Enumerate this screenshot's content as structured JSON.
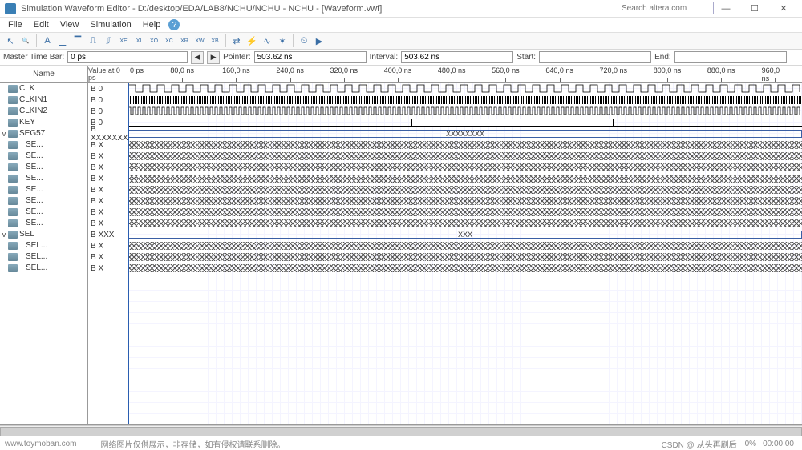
{
  "titlebar": {
    "title": "Simulation Waveform Editor - D:/desktop/EDA/LAB8/NCHU/NCHU - NCHU - [Waveform.vwf]",
    "min": "—",
    "max": "☐",
    "close": "✕"
  },
  "search_placeholder": "Search altera.com",
  "menubar": [
    "File",
    "Edit",
    "View",
    "Simulation",
    "Help"
  ],
  "toolbar_icons": [
    "cursor",
    "zoom",
    "text",
    "wave-a",
    "wave-b",
    "wave-over",
    "wave-under",
    "xe",
    "xi",
    "xo",
    "xc",
    "xr",
    "xw",
    "xb",
    "invert",
    "rand1",
    "rand2",
    "rand3",
    "clock",
    "run"
  ],
  "controlbar": {
    "master_label": "Master Time Bar:",
    "master_value": "0 ps",
    "pointer_label": "Pointer:",
    "pointer_value": "503.62 ns",
    "interval_label": "Interval:",
    "interval_value": "503.62 ns",
    "start_label": "Start:",
    "start_value": "",
    "end_label": "End:",
    "end_value": ""
  },
  "headers": {
    "name": "Name",
    "value": "Value at\n0 ps"
  },
  "ruler": {
    "origin": "0 ps",
    "ticks": [
      "80,0 ns",
      "160,0 ns",
      "240,0 ns",
      "320,0 ns",
      "400,0 ns",
      "480,0 ns",
      "560,0 ns",
      "640,0 ns",
      "720,0 ns",
      "800,0 ns",
      "880,0 ns",
      "960,0 ns"
    ]
  },
  "signals": [
    {
      "name": "CLK",
      "value": "B 0",
      "type": "clk",
      "period": 18
    },
    {
      "name": "CLKIN1",
      "value": "B 0",
      "type": "dense1"
    },
    {
      "name": "CLKIN2",
      "value": "B 0",
      "type": "dense2"
    },
    {
      "name": "KEY",
      "value": "B 0",
      "type": "key"
    },
    {
      "name": "SEG57",
      "value": "B XXXXXXXX",
      "type": "bus",
      "label": "XXXXXXXX",
      "exp": "v"
    },
    {
      "name": "SE...",
      "value": "B X",
      "type": "hatch",
      "sub": true
    },
    {
      "name": "SE...",
      "value": "B X",
      "type": "hatch",
      "sub": true
    },
    {
      "name": "SE...",
      "value": "B X",
      "type": "hatch",
      "sub": true
    },
    {
      "name": "SE...",
      "value": "B X",
      "type": "hatch",
      "sub": true
    },
    {
      "name": "SE...",
      "value": "B X",
      "type": "hatch",
      "sub": true
    },
    {
      "name": "SE...",
      "value": "B X",
      "type": "hatch",
      "sub": true
    },
    {
      "name": "SE...",
      "value": "B X",
      "type": "hatch",
      "sub": true
    },
    {
      "name": "SE...",
      "value": "B X",
      "type": "hatch",
      "sub": true
    },
    {
      "name": "SEL",
      "value": "B XXX",
      "type": "bus",
      "label": "XXX",
      "exp": "v"
    },
    {
      "name": "SEL...",
      "value": "B X",
      "type": "hatch",
      "sub": true
    },
    {
      "name": "SEL...",
      "value": "B X",
      "type": "hatch",
      "sub": true
    },
    {
      "name": "SEL...",
      "value": "B X",
      "type": "hatch",
      "sub": true
    }
  ],
  "footer": {
    "wm1": "www.toymoban.com",
    "wm2": "网络图片仅供展示，非存储，如有侵权请联系删除。",
    "csdn": "CSDN @ 从头再刷后",
    "pct": "0%",
    "time": "00:00:00"
  }
}
